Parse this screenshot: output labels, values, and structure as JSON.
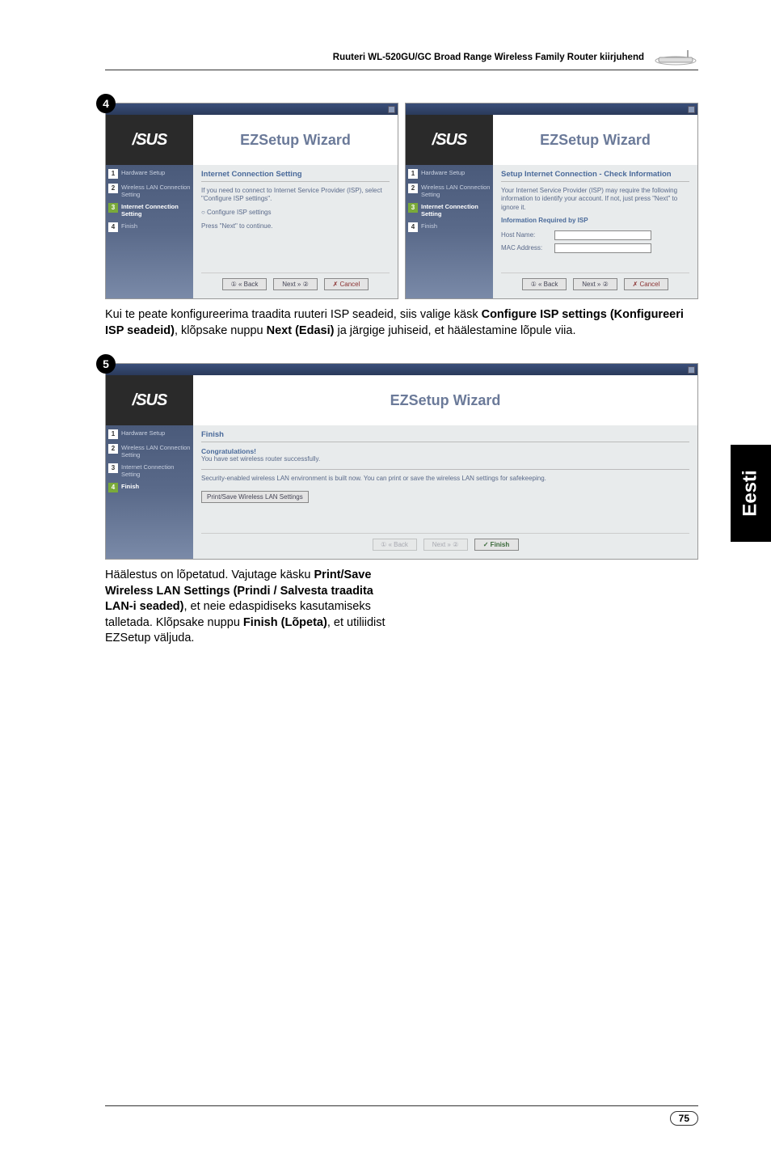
{
  "header": {
    "title": "Ruuteri WL-520GU/GC Broad Range Wireless Family Router kiirjuhend"
  },
  "side_tab": "Eesti",
  "page_number": "75",
  "wizard_common": {
    "logo": "/SUS",
    "title": "EZSetup Wizard",
    "side_steps": {
      "s1": "Hardware Setup",
      "s2": "Wireless LAN Connection Setting",
      "s3": "Internet Connection Setting",
      "s4": "Finish"
    },
    "buttons": {
      "back": "① « Back",
      "next": "Next » ②",
      "cancel": "✗ Cancel",
      "finish": "✓ Finish",
      "back_disabled": "① « Back",
      "next_disabled": "Next » ②"
    }
  },
  "wizard4a": {
    "badge": "4",
    "main_title": "Internet Connection Setting",
    "line1": "If you need to connect to Internet Service Provider (ISP), select \"Configure ISP settings\".",
    "radio": "○ Configure ISP settings",
    "line2": "Press \"Next\" to continue."
  },
  "wizard4b": {
    "main_title": "Setup Internet Connection - Check Information",
    "line1": "Your Internet Service Provider (ISP) may require the following information to identify your account. If not, just press \"Next\" to ignore it.",
    "sub": "Information Required by ISP",
    "field1": "Host Name:",
    "field2": "MAC Address:"
  },
  "wizard5": {
    "badge": "5",
    "main_title": "Finish",
    "congrats": "Congratulations!",
    "line1": "You have set wireless router successfully.",
    "line2": "Security-enabled wireless LAN environment is built now. You can print or save the wireless LAN settings for safekeeping.",
    "print_btn": "Print/Save Wireless LAN Settings"
  },
  "para1": {
    "t1": "Kui te peate konfigureerima traadita ruuteri ISP seadeid, siis valige käsk ",
    "b1": "Configure ISP settings (Konfigureeri ISP seadeid)",
    "t2": ", klõpsake nuppu ",
    "b2": "Next (Edasi)",
    "t3": " ja järgige juhiseid, et häälestamine lõpule viia."
  },
  "para2": {
    "t1": "Häälestus on lõpetatud. Vajutage käsku ",
    "b1": "Print/Save Wireless LAN Settings (Prindi / Salvesta traadita LAN-i seaded)",
    "t2": ", et neie edaspidiseks kasutamiseks talletada. Klõpsake nuppu ",
    "b2": "Finish (Lõpeta)",
    "t3": ", et utiliidist EZSetup väljuda."
  }
}
